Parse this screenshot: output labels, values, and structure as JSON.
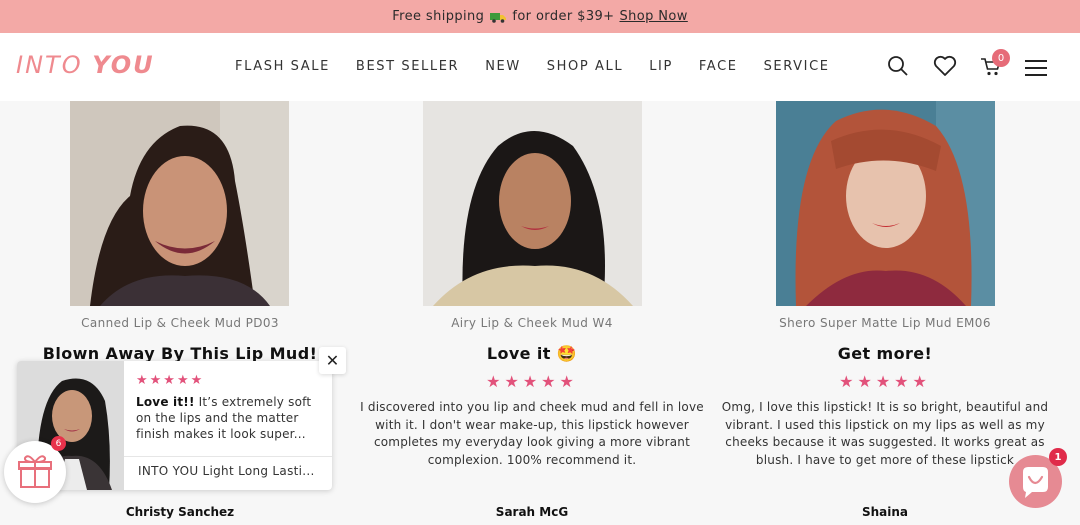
{
  "promo": {
    "text_before": "Free shipping",
    "text_after": "for order $39+",
    "link": "Shop Now"
  },
  "header": {
    "logo_part1": "INTO ",
    "logo_part2": "YOU",
    "nav": [
      "FLASH SALE",
      "BEST SELLER",
      "NEW",
      "SHOP ALL",
      "LIP",
      "FACE",
      "SERVICE"
    ],
    "cart_count": "0",
    "icons": [
      "search-icon",
      "heart-icon",
      "cart-icon",
      "menu-icon"
    ]
  },
  "reviews": [
    {
      "product": "Canned Lip & Cheek Mud PD03",
      "title": "Blown Away By This Lip Mud!",
      "stars": "★★★★★",
      "body": "",
      "author": "Christy Sanchez"
    },
    {
      "product": "Airy Lip & Cheek Mud W4",
      "title": "Love it 🤩",
      "stars": "★★★★★",
      "body": "I discovered into you lip and cheek mud and fell in love with it. I don't wear make-up, this lipstick however completes my everyday look giving a more vibrant complexion. 100% recommend it.",
      "author": "Sarah McG"
    },
    {
      "product": "Shero Super Matte Lip Mud EM06",
      "title": "Get more!",
      "stars": "★★★★★",
      "body": "Omg, I love this lipstick! It is so bright, beautiful and vibrant. I used this lipstick on my lips as well as my cheeks because it was suggested. It works great as blush. I have to get more of these lipstick",
      "author": "Shaina"
    }
  ],
  "popup": {
    "stars": "★★★★★",
    "bold": "Love it!!",
    "text": " It’s extremely soft on the lips and the matter finish makes it look super...",
    "product": "INTO YOU Light Long Lasti..."
  },
  "gift_badge": "6",
  "chat_badge": "1",
  "colors": {
    "brand": "#ef8a8f",
    "promo_bg": "#f3a9a6",
    "star": "#e2527b",
    "chat": "#e68a93"
  }
}
